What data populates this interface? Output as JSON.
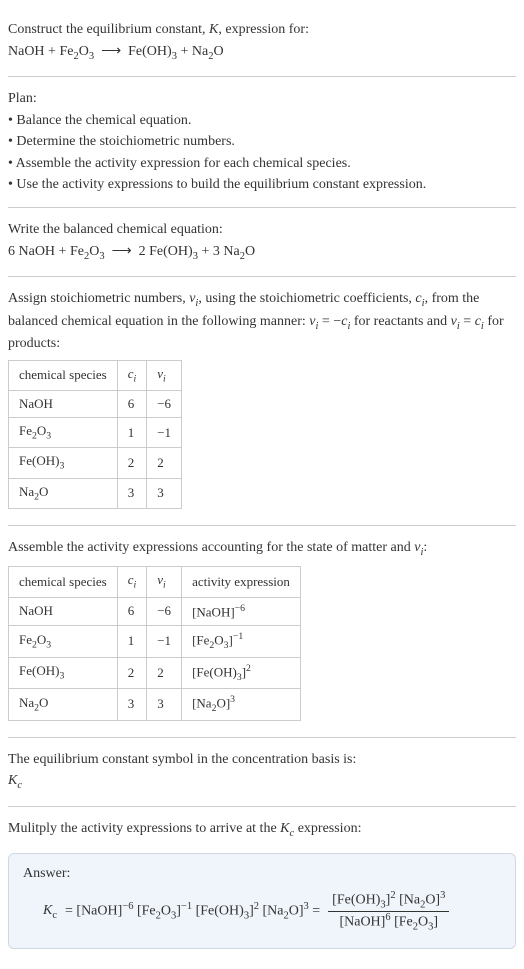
{
  "intro": {
    "line1_pre": "Construct the equilibrium constant, ",
    "line1_k": "K",
    "line1_post": ", expression for:",
    "equation_html": "NaOH + Fe<span class='sub'>2</span>O<span class='sub'>3</span>&nbsp; ⟶ &nbsp;Fe(OH)<span class='sub'>3</span> + Na<span class='sub'>2</span>O"
  },
  "plan": {
    "heading": "Plan:",
    "items": [
      "• Balance the chemical equation.",
      "• Determine the stoichiometric numbers.",
      "• Assemble the activity expression for each chemical species.",
      "• Use the activity expressions to build the equilibrium constant expression."
    ]
  },
  "balance": {
    "heading": "Write the balanced chemical equation:",
    "equation_html": "6 NaOH + Fe<span class='sub'>2</span>O<span class='sub'>3</span>&nbsp; ⟶ &nbsp;2 Fe(OH)<span class='sub'>3</span> + 3 Na<span class='sub'>2</span>O"
  },
  "stoich": {
    "para_html": "Assign stoichiometric numbers, <span class='var'>ν<span class='sub'>i</span></span>, using the stoichiometric coefficients, <span class='var'>c<span class='sub'>i</span></span>, from the balanced chemical equation in the following manner: <span class='var'>ν<span class='sub'>i</span></span> = −<span class='var'>c<span class='sub'>i</span></span> for reactants and <span class='var'>ν<span class='sub'>i</span></span> = <span class='var'>c<span class='sub'>i</span></span> for products:",
    "headers": [
      "chemical species",
      "c_i",
      "nu_i"
    ],
    "header_html": [
      "chemical species",
      "<span class='var'>c<span class='sub'>i</span></span>",
      "<span class='var'>ν<span class='sub'>i</span></span>"
    ],
    "rows": [
      {
        "species_html": "NaOH",
        "c": "6",
        "nu": "−6"
      },
      {
        "species_html": "Fe<span class='sub'>2</span>O<span class='sub'>3</span>",
        "c": "1",
        "nu": "−1"
      },
      {
        "species_html": "Fe(OH)<span class='sub'>3</span>",
        "c": "2",
        "nu": "2"
      },
      {
        "species_html": "Na<span class='sub'>2</span>O",
        "c": "3",
        "nu": "3"
      }
    ]
  },
  "activity": {
    "para_html": "Assemble the activity expressions accounting for the state of matter and <span class='var'>ν<span class='sub'>i</span></span>:",
    "header_html": [
      "chemical species",
      "<span class='var'>c<span class='sub'>i</span></span>",
      "<span class='var'>ν<span class='sub'>i</span></span>",
      "activity expression"
    ],
    "rows": [
      {
        "species_html": "NaOH",
        "c": "6",
        "nu": "−6",
        "expr_html": "[NaOH]<span class='sup'>−6</span>"
      },
      {
        "species_html": "Fe<span class='sub'>2</span>O<span class='sub'>3</span>",
        "c": "1",
        "nu": "−1",
        "expr_html": "[Fe<span class='sub'>2</span>O<span class='sub'>3</span>]<span class='sup'>−1</span>"
      },
      {
        "species_html": "Fe(OH)<span class='sub'>3</span>",
        "c": "2",
        "nu": "2",
        "expr_html": "[Fe(OH)<span class='sub'>3</span>]<span class='sup'>2</span>"
      },
      {
        "species_html": "Na<span class='sub'>2</span>O",
        "c": "3",
        "nu": "3",
        "expr_html": "[Na<span class='sub'>2</span>O]<span class='sup'>3</span>"
      }
    ]
  },
  "kc_symbol": {
    "line1": "The equilibrium constant symbol in the concentration basis is:",
    "symbol_html": "<span class='var'>K<span class='sub'>c</span></span>"
  },
  "multiply": {
    "para_html": "Mulitply the activity expressions to arrive at the <span class='var'>K<span class='sub'>c</span></span> expression:"
  },
  "answer": {
    "label": "Answer:",
    "kc_html": "K<span class='sub' style='font-style:normal'>c</span>",
    "eq1_html": "= [NaOH]<span class='sup'>−6</span> [Fe<span class='sub'>2</span>O<span class='sub'>3</span>]<span class='sup'>−1</span> [Fe(OH)<span class='sub'>3</span>]<span class='sup'>2</span> [Na<span class='sub'>2</span>O]<span class='sup'>3</span> =",
    "frac_num_html": "[Fe(OH)<span class='sub'>3</span>]<span class='sup'>2</span> [Na<span class='sub'>2</span>O]<span class='sup'>3</span>",
    "frac_den_html": "[NaOH]<span class='sup'>6</span> [Fe<span class='sub'>2</span>O<span class='sub'>3</span>]"
  }
}
